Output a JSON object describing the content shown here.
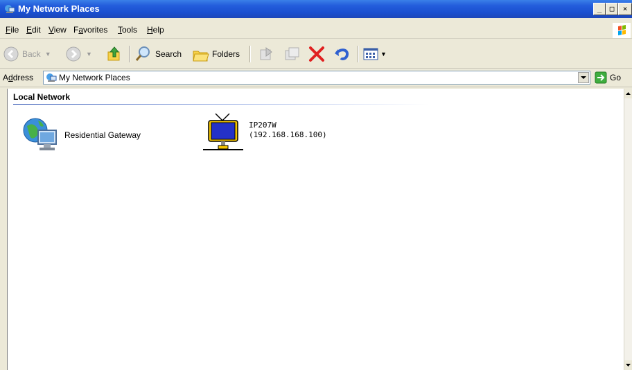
{
  "window": {
    "title": "My Network Places"
  },
  "title_buttons": {
    "minimize": "_",
    "maximize": "□",
    "close": "×"
  },
  "menu": {
    "items": [
      {
        "label": "File",
        "underline": "F",
        "rest": "ile"
      },
      {
        "label": "Edit",
        "underline": "E",
        "rest": "dit"
      },
      {
        "label": "View",
        "underline": "V",
        "rest": "iew"
      },
      {
        "label": "Favorites",
        "pre": "F",
        "underline": "a",
        "rest": "vorites"
      },
      {
        "label": "Tools",
        "underline": "T",
        "rest": "ools"
      },
      {
        "label": "Help",
        "underline": "H",
        "rest": "elp"
      }
    ]
  },
  "toolbar": {
    "back_label": "Back",
    "search_label": "Search",
    "folders_label": "Folders"
  },
  "address": {
    "label_pre": "A",
    "label_underline": "d",
    "label_rest": "dress",
    "value": "My Network Places",
    "go_label": "Go"
  },
  "content": {
    "group_title": "Local Network",
    "items": [
      {
        "label": "Residential Gateway"
      },
      {
        "name": "IP207W",
        "ip": "(192.168.168.100)"
      }
    ]
  },
  "colors": {
    "titlebar": "#245edc",
    "close_x": "#e02020",
    "accent_blue": "#3d5fb8"
  }
}
